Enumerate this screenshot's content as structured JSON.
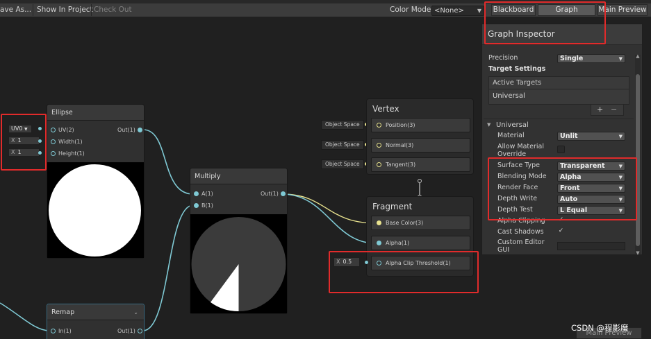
{
  "toolbar": {
    "save_as": "ave As...",
    "show_in_project": "Show In Project",
    "check_out": "Check Out",
    "color_mode_label": "Color Mode",
    "color_mode_value": "<None>",
    "blackboard": "Blackboard",
    "graph_inspector": "Graph Inspector",
    "main_preview": "Main Preview"
  },
  "nodes": {
    "ellipse": {
      "title": "Ellipse",
      "inputs": [
        "UV(2)",
        "Width(1)",
        "Height(1)"
      ],
      "output": "Out(1)",
      "uv_field": "UV0",
      "width_label": "X",
      "width_value": "1",
      "height_label": "X",
      "height_value": "1"
    },
    "multiply": {
      "title": "Multiply",
      "inputs": [
        "A(1)",
        "B(1)"
      ],
      "output": "Out(1)"
    },
    "remap": {
      "title": "Remap",
      "input": "In(1)",
      "output": "Out(1)"
    }
  },
  "vertex": {
    "title": "Vertex",
    "blocks": [
      "Position(3)",
      "Normal(3)",
      "Tangent(3)"
    ],
    "space_label": "Object Space"
  },
  "fragment": {
    "title": "Fragment",
    "blocks": [
      "Base Color(3)",
      "Alpha(1)",
      "Alpha Clip Threshold(1)"
    ],
    "threshold_label": "X",
    "threshold_value": "0.5"
  },
  "inspector": {
    "title": "Graph Inspector",
    "precision_label": "Precision",
    "precision_value": "Single",
    "target_settings": "Target Settings",
    "active_targets": "Active Targets",
    "target_universal": "Universal",
    "add_symbol": "+",
    "remove_symbol": "−",
    "section_universal": "Universal",
    "material_label": "Material",
    "material_value": "Unlit",
    "allow_override_label": "Allow Material Override",
    "surface_type_label": "Surface Type",
    "surface_type_value": "Transparent",
    "blending_mode_label": "Blending Mode",
    "blending_mode_value": "Alpha",
    "render_face_label": "Render Face",
    "render_face_value": "Front",
    "depth_write_label": "Depth Write",
    "depth_write_value": "Auto",
    "depth_test_label": "Depth Test",
    "depth_test_value": "L Equal",
    "alpha_clipping_label": "Alpha Clipping",
    "cast_shadows_label": "Cast Shadows",
    "custom_editor_label": "Custom Editor GUI",
    "check_mark": "✓"
  },
  "watermark": "CSDN @程影魔",
  "bottom_main_preview": "Main Preview",
  "colors": {
    "wire": "#7fc9d4",
    "wire_yellow": "#e8e28e",
    "annotation_red": "#e12b2b"
  }
}
